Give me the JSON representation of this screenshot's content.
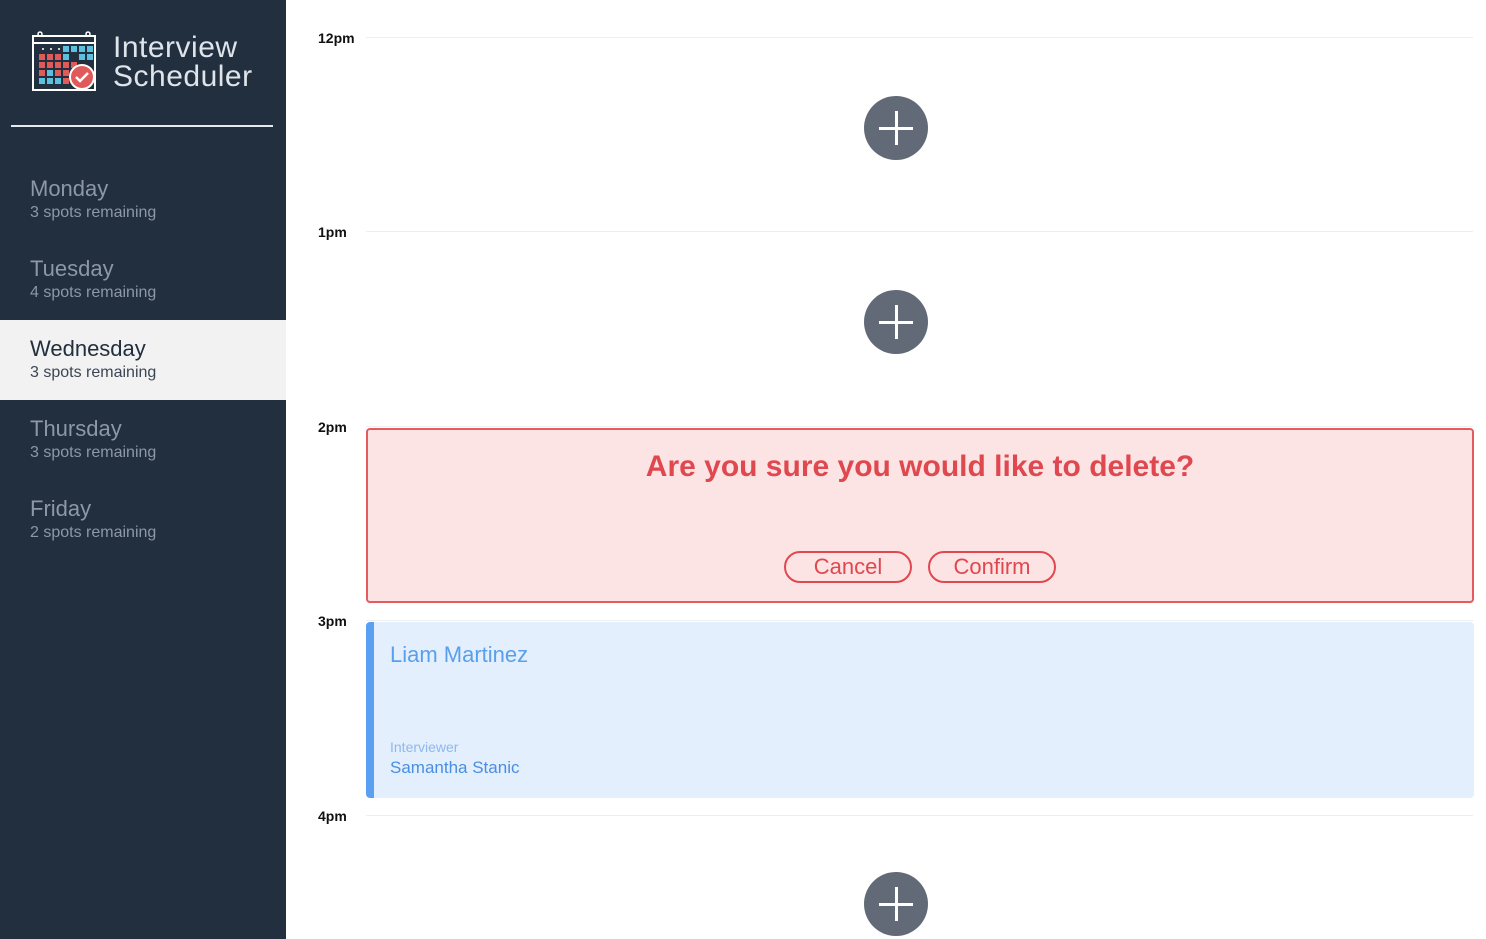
{
  "app": {
    "title_line1": "Interview",
    "title_line2": "Scheduler",
    "logo_icon": "calendar-check-icon"
  },
  "colors": {
    "sidebar_bg": "#222f3e",
    "selected_day_bg": "#f2f2f2",
    "danger": "#e0484f",
    "danger_bg": "#fce3e4",
    "info": "#5aa0f2",
    "info_bg": "#e3effd",
    "add_button": "#616a76"
  },
  "days": [
    {
      "name": "Monday",
      "spots": "3 spots remaining",
      "selected": false
    },
    {
      "name": "Tuesday",
      "spots": "4 spots remaining",
      "selected": false
    },
    {
      "name": "Wednesday",
      "spots": "3 spots remaining",
      "selected": true
    },
    {
      "name": "Thursday",
      "spots": "3 spots remaining",
      "selected": false
    },
    {
      "name": "Friday",
      "spots": "2 spots remaining",
      "selected": false
    }
  ],
  "schedule": {
    "slots": [
      {
        "time": "12pm",
        "state": "empty",
        "icon": "plus-icon"
      },
      {
        "time": "1pm",
        "state": "empty",
        "icon": "plus-icon"
      },
      {
        "time": "2pm",
        "state": "confirm",
        "message": "Are you sure you would like to delete?",
        "cancel_label": "Cancel",
        "confirm_label": "Confirm"
      },
      {
        "time": "3pm",
        "state": "booked",
        "student": "Liam Martinez",
        "interviewer_label": "Interviewer",
        "interviewer": "Samantha Stanic"
      },
      {
        "time": "4pm",
        "state": "empty",
        "icon": "plus-icon"
      }
    ]
  }
}
